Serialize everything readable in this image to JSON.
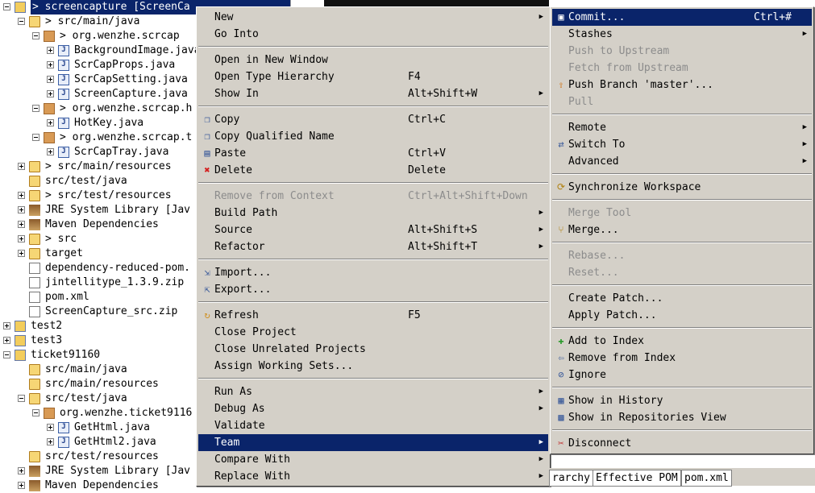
{
  "tree": {
    "rows": [
      {
        "label": "> screencapture  [ScreenCa",
        "indent": 0,
        "icon": "project-icon",
        "expander": "minus",
        "selected": true
      },
      {
        "label": "> src/main/java",
        "indent": 1,
        "icon": "source-folder-icon",
        "expander": "minus"
      },
      {
        "label": "> org.wenzhe.scrcap",
        "indent": 2,
        "icon": "package-icon",
        "expander": "minus"
      },
      {
        "label": "BackgroundImage.java",
        "indent": 3,
        "icon": "java-file-icon",
        "expander": "plus"
      },
      {
        "label": "ScrCapProps.java",
        "indent": 3,
        "icon": "java-file-icon",
        "expander": "plus"
      },
      {
        "label": "ScrCapSetting.java",
        "indent": 3,
        "icon": "java-file-icon",
        "expander": "plus"
      },
      {
        "label": "ScreenCapture.java",
        "indent": 3,
        "icon": "java-file-icon",
        "expander": "plus"
      },
      {
        "label": "> org.wenzhe.scrcap.h",
        "indent": 2,
        "icon": "package-icon",
        "expander": "minus"
      },
      {
        "label": "HotKey.java",
        "indent": 3,
        "icon": "java-file-icon",
        "expander": "plus"
      },
      {
        "label": "> org.wenzhe.scrcap.t",
        "indent": 2,
        "icon": "package-icon",
        "expander": "minus"
      },
      {
        "label": "ScrCapTray.java",
        "indent": 3,
        "icon": "java-file-icon",
        "expander": "plus"
      },
      {
        "label": "> src/main/resources",
        "indent": 1,
        "icon": "source-folder-icon",
        "expander": "plus"
      },
      {
        "label": "src/test/java",
        "indent": 1,
        "icon": "source-folder-icon",
        "expander": ""
      },
      {
        "label": "> src/test/resources",
        "indent": 1,
        "icon": "source-folder-icon",
        "expander": "plus"
      },
      {
        "label": "JRE System Library [Jav",
        "indent": 1,
        "icon": "library-icon",
        "expander": "plus"
      },
      {
        "label": "Maven Dependencies",
        "indent": 1,
        "icon": "library-icon",
        "expander": "plus"
      },
      {
        "label": "> src",
        "indent": 1,
        "icon": "folder-icon",
        "expander": "plus"
      },
      {
        "label": "target",
        "indent": 1,
        "icon": "folder-icon",
        "expander": "plus"
      },
      {
        "label": "dependency-reduced-pom.",
        "indent": 1,
        "icon": "xml-file-icon",
        "expander": ""
      },
      {
        "label": "jintellitype_1.3.9.zip",
        "indent": 1,
        "icon": "file-icon",
        "expander": ""
      },
      {
        "label": "pom.xml",
        "indent": 1,
        "icon": "xml-file-icon",
        "expander": ""
      },
      {
        "label": "ScreenCapture_src.zip",
        "indent": 1,
        "icon": "file-icon",
        "expander": ""
      },
      {
        "label": "test2",
        "indent": 0,
        "icon": "project-icon",
        "expander": "plus"
      },
      {
        "label": "test3",
        "indent": 0,
        "icon": "project-icon",
        "expander": "plus"
      },
      {
        "label": "ticket91160",
        "indent": 0,
        "icon": "project-icon",
        "expander": "minus"
      },
      {
        "label": "src/main/java",
        "indent": 1,
        "icon": "source-folder-icon",
        "expander": ""
      },
      {
        "label": "src/main/resources",
        "indent": 1,
        "icon": "source-folder-icon",
        "expander": ""
      },
      {
        "label": "src/test/java",
        "indent": 1,
        "icon": "source-folder-icon",
        "expander": "minus"
      },
      {
        "label": "org.wenzhe.ticket9116",
        "indent": 2,
        "icon": "package-icon",
        "expander": "minus"
      },
      {
        "label": "GetHtml.java",
        "indent": 3,
        "icon": "java-file-icon",
        "expander": "plus"
      },
      {
        "label": "GetHtml2.java",
        "indent": 3,
        "icon": "java-file-icon",
        "expander": "plus"
      },
      {
        "label": "src/test/resources",
        "indent": 1,
        "icon": "source-folder-icon",
        "expander": ""
      },
      {
        "label": "JRE System Library [Jav",
        "indent": 1,
        "icon": "library-icon",
        "expander": "plus"
      },
      {
        "label": "Maven Dependencies",
        "indent": 1,
        "icon": "library-icon",
        "expander": "plus"
      }
    ]
  },
  "context_menu": {
    "items": [
      {
        "type": "item",
        "label": "New",
        "accel": "",
        "submenu": true,
        "icon": ""
      },
      {
        "type": "item",
        "label": "Go Into",
        "accel": "",
        "submenu": false,
        "icon": ""
      },
      {
        "type": "sep"
      },
      {
        "type": "item",
        "label": "Open in New Window",
        "accel": "",
        "submenu": false,
        "icon": ""
      },
      {
        "type": "item",
        "label": "Open Type Hierarchy",
        "accel": "F4",
        "submenu": false,
        "icon": ""
      },
      {
        "type": "item",
        "label": "Show In",
        "accel": "Alt+Shift+W",
        "submenu": true,
        "icon": ""
      },
      {
        "type": "sep"
      },
      {
        "type": "item",
        "label": "Copy",
        "accel": "Ctrl+C",
        "submenu": false,
        "icon": "copy-icon"
      },
      {
        "type": "item",
        "label": "Copy Qualified Name",
        "accel": "",
        "submenu": false,
        "icon": "copy-icon"
      },
      {
        "type": "item",
        "label": "Paste",
        "accel": "Ctrl+V",
        "submenu": false,
        "icon": "paste-icon"
      },
      {
        "type": "item",
        "label": "Delete",
        "accel": "Delete",
        "submenu": false,
        "icon": "delete-icon"
      },
      {
        "type": "sep"
      },
      {
        "type": "item",
        "label": "Remove from Context",
        "accel": "Ctrl+Alt+Shift+Down",
        "submenu": false,
        "disabled": true,
        "icon": ""
      },
      {
        "type": "item",
        "label": "Build Path",
        "accel": "",
        "submenu": true,
        "icon": ""
      },
      {
        "type": "item",
        "label": "Source",
        "accel": "Alt+Shift+S",
        "submenu": true,
        "icon": ""
      },
      {
        "type": "item",
        "label": "Refactor",
        "accel": "Alt+Shift+T",
        "submenu": true,
        "icon": ""
      },
      {
        "type": "sep"
      },
      {
        "type": "item",
        "label": "Import...",
        "accel": "",
        "submenu": false,
        "icon": "import-icon"
      },
      {
        "type": "item",
        "label": "Export...",
        "accel": "",
        "submenu": false,
        "icon": "export-icon"
      },
      {
        "type": "sep"
      },
      {
        "type": "item",
        "label": "Refresh",
        "accel": "F5",
        "submenu": false,
        "icon": "refresh-icon"
      },
      {
        "type": "item",
        "label": "Close Project",
        "accel": "",
        "submenu": false,
        "icon": ""
      },
      {
        "type": "item",
        "label": "Close Unrelated Projects",
        "accel": "",
        "submenu": false,
        "icon": ""
      },
      {
        "type": "item",
        "label": "Assign Working Sets...",
        "accel": "",
        "submenu": false,
        "icon": ""
      },
      {
        "type": "sep"
      },
      {
        "type": "item",
        "label": "Run As",
        "accel": "",
        "submenu": true,
        "icon": ""
      },
      {
        "type": "item",
        "label": "Debug As",
        "accel": "",
        "submenu": true,
        "icon": ""
      },
      {
        "type": "item",
        "label": "Validate",
        "accel": "",
        "submenu": false,
        "icon": ""
      },
      {
        "type": "item",
        "label": "Team",
        "accel": "",
        "submenu": true,
        "highlighted": true,
        "icon": ""
      },
      {
        "type": "item",
        "label": "Compare With",
        "accel": "",
        "submenu": true,
        "icon": ""
      },
      {
        "type": "item",
        "label": "Replace With",
        "accel": "",
        "submenu": true,
        "icon": ""
      }
    ]
  },
  "team_menu": {
    "items": [
      {
        "type": "item",
        "label": "Commit...",
        "accel": "Ctrl+#",
        "submenu": false,
        "highlighted": true,
        "icon": "commit-icon"
      },
      {
        "type": "item",
        "label": "Stashes",
        "accel": "",
        "submenu": true,
        "icon": ""
      },
      {
        "type": "item",
        "label": "Push to Upstream",
        "accel": "",
        "submenu": false,
        "disabled": true,
        "icon": ""
      },
      {
        "type": "item",
        "label": "Fetch from Upstream",
        "accel": "",
        "submenu": false,
        "disabled": true,
        "icon": ""
      },
      {
        "type": "item",
        "label": "Push Branch 'master'...",
        "accel": "",
        "submenu": false,
        "icon": "push-icon"
      },
      {
        "type": "item",
        "label": "Pull",
        "accel": "",
        "submenu": false,
        "disabled": true,
        "icon": ""
      },
      {
        "type": "sep"
      },
      {
        "type": "item",
        "label": "Remote",
        "accel": "",
        "submenu": true,
        "icon": ""
      },
      {
        "type": "item",
        "label": "Switch To",
        "accel": "",
        "submenu": true,
        "icon": "switch-icon"
      },
      {
        "type": "item",
        "label": "Advanced",
        "accel": "",
        "submenu": true,
        "icon": ""
      },
      {
        "type": "sep"
      },
      {
        "type": "item",
        "label": "Synchronize Workspace",
        "accel": "",
        "submenu": false,
        "icon": "sync-icon"
      },
      {
        "type": "sep"
      },
      {
        "type": "item",
        "label": "Merge Tool",
        "accel": "",
        "submenu": false,
        "disabled": true,
        "icon": ""
      },
      {
        "type": "item",
        "label": "Merge...",
        "accel": "",
        "submenu": false,
        "icon": "merge-icon"
      },
      {
        "type": "sep"
      },
      {
        "type": "item",
        "label": "Rebase...",
        "accel": "",
        "submenu": false,
        "disabled": true,
        "icon": ""
      },
      {
        "type": "item",
        "label": "Reset...",
        "accel": "",
        "submenu": false,
        "disabled": true,
        "icon": ""
      },
      {
        "type": "sep"
      },
      {
        "type": "item",
        "label": "Create Patch...",
        "accel": "",
        "submenu": false,
        "icon": ""
      },
      {
        "type": "item",
        "label": "Apply Patch...",
        "accel": "",
        "submenu": false,
        "icon": ""
      },
      {
        "type": "sep"
      },
      {
        "type": "item",
        "label": "Add to Index",
        "accel": "",
        "submenu": false,
        "icon": "add-index-icon"
      },
      {
        "type": "item",
        "label": "Remove from Index",
        "accel": "",
        "submenu": false,
        "icon": "remove-index-icon"
      },
      {
        "type": "item",
        "label": "Ignore",
        "accel": "",
        "submenu": false,
        "icon": "ignore-icon"
      },
      {
        "type": "sep"
      },
      {
        "type": "item",
        "label": "Show in History",
        "accel": "",
        "submenu": false,
        "icon": "history-icon"
      },
      {
        "type": "item",
        "label": "Show in Repositories View",
        "accel": "",
        "submenu": false,
        "icon": "repositories-icon"
      },
      {
        "type": "sep"
      },
      {
        "type": "item",
        "label": "Disconnect",
        "accel": "",
        "submenu": false,
        "icon": "disconnect-icon"
      }
    ]
  },
  "bottom_tabs": [
    "rarchy",
    "Effective POM",
    "pom.xml"
  ],
  "colors": {
    "highlight": "#0a246a",
    "menu_bg": "#d4d0c8",
    "disabled": "#8c8c8c"
  }
}
